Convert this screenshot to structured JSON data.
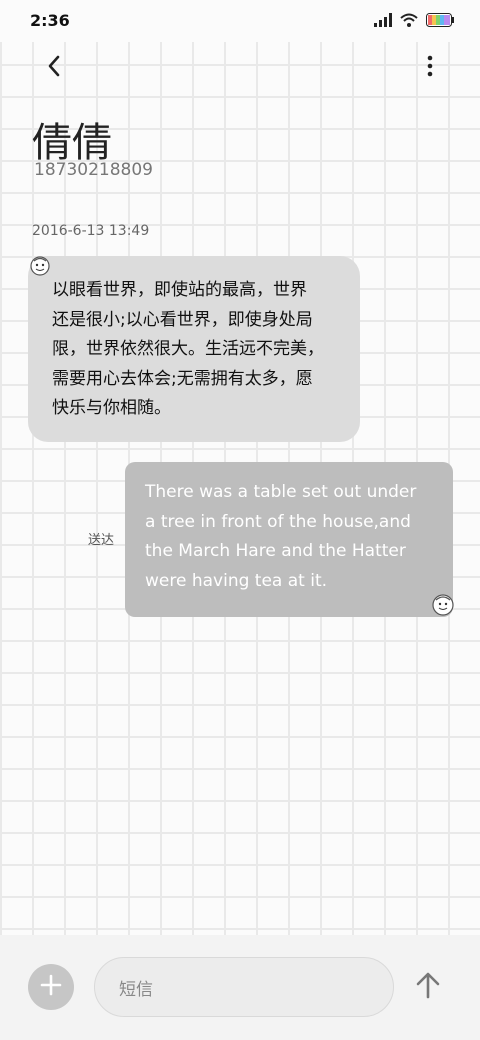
{
  "status_bar": {
    "time": "2:36",
    "icons": [
      "signal-icon",
      "wifi-icon",
      "battery-icon"
    ]
  },
  "header": {
    "back_icon": "chevron-left-icon",
    "more_icon": "more-vertical-icon",
    "contact_name": "倩倩",
    "contact_phone": "18730218809"
  },
  "conversation": {
    "timestamp": "2016-6-13 13:49",
    "messages": [
      {
        "direction": "incoming",
        "lines": [
          "以眼看世界，即使站的最高，世界",
          "还是很小;以心看世界，即使身处局",
          "限，世界依然很大。生活远不完美，",
          "需要用心去体会;无需拥有太多，愿",
          "快乐与你相随。"
        ]
      },
      {
        "direction": "outgoing",
        "status": "送达",
        "lines": [
          "There was a table set out under",
          "a tree in front of the house,and",
          "the March Hare and the Hatter",
          "were having tea at it."
        ]
      }
    ]
  },
  "composer": {
    "add_icon": "plus-icon",
    "placeholder": "短信",
    "send_icon": "arrow-up-icon"
  },
  "colors": {
    "incoming_bubble": "#dcdcdc",
    "outgoing_bubble": "#bdbdbd",
    "grid_line": "#e9e9e9"
  }
}
